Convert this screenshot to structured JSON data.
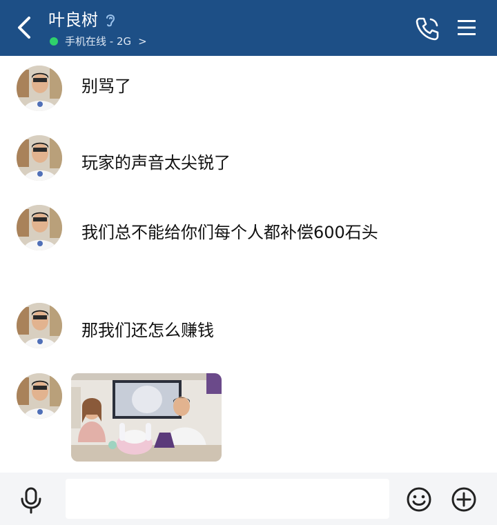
{
  "header": {
    "back_icon": "chevron-left-icon",
    "contact_name": "叶良树",
    "ear_icon": "ear-icon",
    "status_text": "手机在线 - 2G",
    "status_chevron": ">",
    "phone_icon": "phone-icon",
    "menu_icon": "menu-icon"
  },
  "messages": [
    {
      "type": "text",
      "text": "别骂了"
    },
    {
      "type": "text",
      "text": "玩家的声音太尖锐了"
    },
    {
      "type": "text",
      "text": "我们总不能给你们每个人都补偿600石头"
    },
    {
      "type": "text",
      "text": "那我们还怎么赚钱"
    },
    {
      "type": "image",
      "text": ""
    }
  ],
  "input_bar": {
    "mic_icon": "microphone-icon",
    "input_value": "",
    "emoji_icon": "emoji-icon",
    "plus_icon": "plus-circle-icon"
  },
  "colors": {
    "header_bg": "#1d4f86",
    "online_dot": "#2fd16b",
    "input_bar_bg": "#f4f5f7"
  }
}
